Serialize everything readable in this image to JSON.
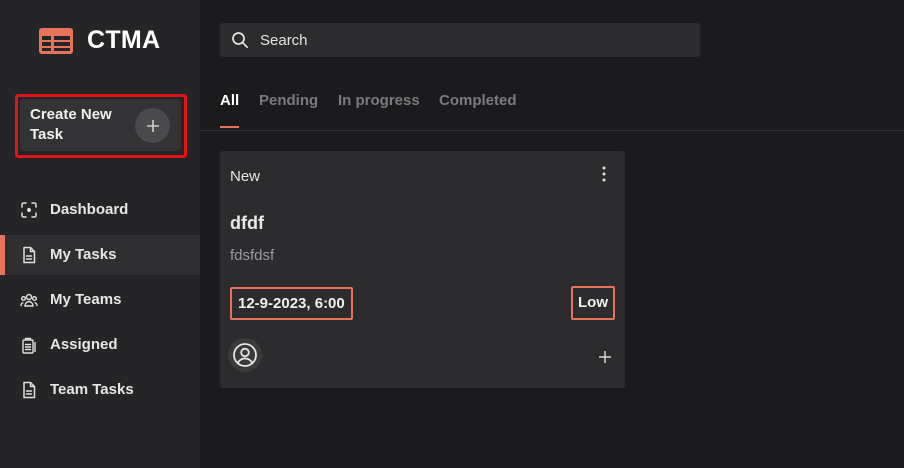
{
  "app": {
    "name": "CTMA",
    "accent_color": "#e8735d",
    "highlight_color": "#e0141a"
  },
  "sidebar": {
    "create_button": {
      "label": "Create New Task",
      "icon": "plus-icon"
    },
    "items": [
      {
        "label": "Dashboard",
        "icon": "dashboard-icon",
        "active": false
      },
      {
        "label": "My Tasks",
        "icon": "document-icon",
        "active": true
      },
      {
        "label": "My Teams",
        "icon": "team-icon",
        "active": false
      },
      {
        "label": "Assigned",
        "icon": "clipboard-icon",
        "active": false
      },
      {
        "label": "Team Tasks",
        "icon": "document-icon",
        "active": false
      }
    ]
  },
  "search": {
    "placeholder": "Search",
    "value": ""
  },
  "tabs": [
    {
      "label": "All",
      "active": true
    },
    {
      "label": "Pending",
      "active": false
    },
    {
      "label": "In progress",
      "active": false
    },
    {
      "label": "Completed",
      "active": false
    }
  ],
  "tasks": [
    {
      "status": "New",
      "title": "dfdf",
      "description": "fdsfdsf",
      "due": "12-9-2023, 6:00",
      "priority": "Low"
    }
  ]
}
